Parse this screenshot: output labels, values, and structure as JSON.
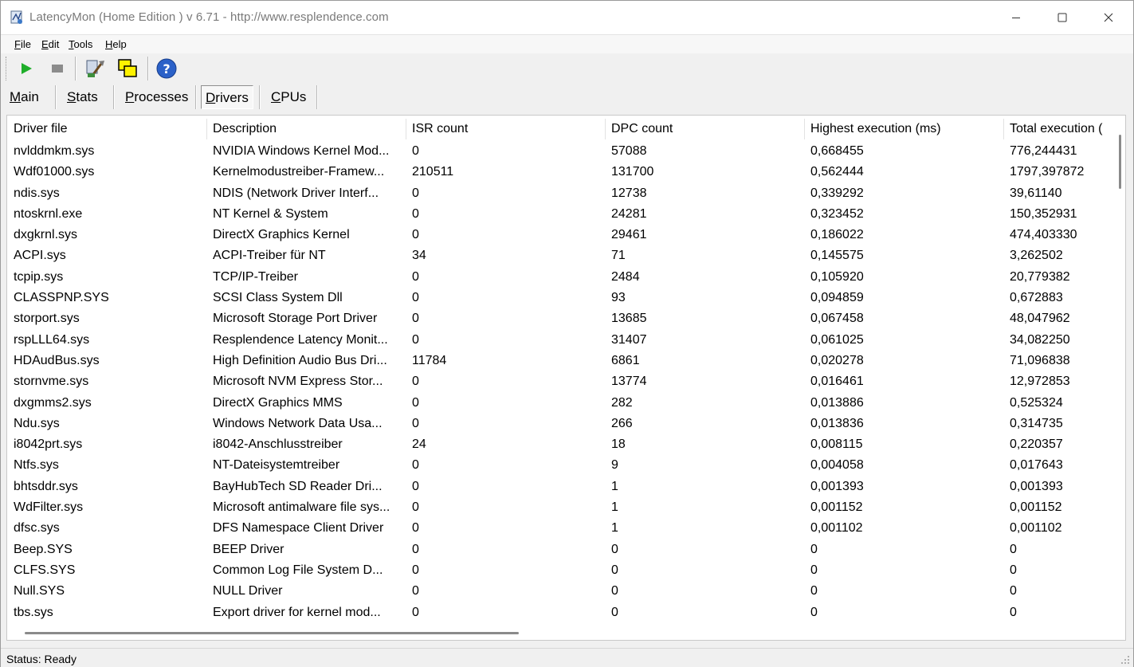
{
  "window": {
    "title": "LatencyMon  (Home Edition )  v 6.71 - http://www.resplendence.com"
  },
  "menu": [
    {
      "hotkey": "F",
      "rest": "ile"
    },
    {
      "hotkey": "E",
      "rest": "dit"
    },
    {
      "hotkey": "T",
      "rest": "ools"
    },
    {
      "hotkey": "H",
      "rest": "elp"
    }
  ],
  "toolbar": {
    "icons": [
      "play-icon",
      "stop-icon",
      "tool-icon",
      "windows-icon",
      "help-icon"
    ],
    "colors": {
      "play": "#1fae2a",
      "stop": "#8c8c8c",
      "help": "#2b61c8"
    }
  },
  "tabs": [
    {
      "hotkey": "M",
      "rest": "ain",
      "active": false
    },
    {
      "hotkey": "S",
      "rest": "tats",
      "active": false
    },
    {
      "hotkey": "P",
      "rest": "rocesses",
      "active": false
    },
    {
      "hotkey": "D",
      "rest": "rivers",
      "active": true
    },
    {
      "hotkey": "C",
      "rest": "PUs",
      "active": false
    }
  ],
  "columns": [
    "Driver file",
    "Description",
    "ISR count",
    "DPC count",
    "Highest execution (ms)",
    "Total execution ("
  ],
  "rows": [
    [
      "nvlddmkm.sys",
      "NVIDIA Windows Kernel Mod...",
      "0",
      "57088",
      "0,668455",
      "776,244431"
    ],
    [
      "Wdf01000.sys",
      "Kernelmodustreiber-Framew...",
      "210511",
      "131700",
      "0,562444",
      "1797,397872"
    ],
    [
      "ndis.sys",
      "NDIS (Network Driver Interf...",
      "0",
      "12738",
      "0,339292",
      "39,61140"
    ],
    [
      "ntoskrnl.exe",
      "NT Kernel & System",
      "0",
      "24281",
      "0,323452",
      "150,352931"
    ],
    [
      "dxgkrnl.sys",
      "DirectX Graphics Kernel",
      "0",
      "29461",
      "0,186022",
      "474,403330"
    ],
    [
      "ACPI.sys",
      "ACPI-Treiber für NT",
      "34",
      "71",
      "0,145575",
      "3,262502"
    ],
    [
      "tcpip.sys",
      "TCP/IP-Treiber",
      "0",
      "2484",
      "0,105920",
      "20,779382"
    ],
    [
      "CLASSPNP.SYS",
      "SCSI Class System Dll",
      "0",
      "93",
      "0,094859",
      "0,672883"
    ],
    [
      "storport.sys",
      "Microsoft Storage Port Driver",
      "0",
      "13685",
      "0,067458",
      "48,047962"
    ],
    [
      "rspLLL64.sys",
      "Resplendence Latency Monit...",
      "0",
      "31407",
      "0,061025",
      "34,082250"
    ],
    [
      "HDAudBus.sys",
      "High Definition Audio Bus Dri...",
      "11784",
      "6861",
      "0,020278",
      "71,096838"
    ],
    [
      "stornvme.sys",
      "Microsoft NVM Express Stor...",
      "0",
      "13774",
      "0,016461",
      "12,972853"
    ],
    [
      "dxgmms2.sys",
      "DirectX Graphics MMS",
      "0",
      "282",
      "0,013886",
      "0,525324"
    ],
    [
      "Ndu.sys",
      "Windows Network Data Usa...",
      "0",
      "266",
      "0,013836",
      "0,314735"
    ],
    [
      "i8042prt.sys",
      "i8042-Anschlusstreiber",
      "24",
      "18",
      "0,008115",
      "0,220357"
    ],
    [
      "Ntfs.sys",
      "NT-Dateisystemtreiber",
      "0",
      "9",
      "0,004058",
      "0,017643"
    ],
    [
      "bhtsddr.sys",
      "BayHubTech SD Reader Dri...",
      "0",
      "1",
      "0,001393",
      "0,001393"
    ],
    [
      "WdFilter.sys",
      "Microsoft antimalware file sys...",
      "0",
      "1",
      "0,001152",
      "0,001152"
    ],
    [
      "dfsc.sys",
      "DFS Namespace Client Driver",
      "0",
      "1",
      "0,001102",
      "0,001102"
    ],
    [
      "Beep.SYS",
      "BEEP Driver",
      "0",
      "0",
      "0",
      "0"
    ],
    [
      "CLFS.SYS",
      "Common Log File System D...",
      "0",
      "0",
      "0",
      "0"
    ],
    [
      "Null.SYS",
      "NULL Driver",
      "0",
      "0",
      "0",
      "0"
    ],
    [
      "tbs.sys",
      "Export driver for kernel mod...",
      "0",
      "0",
      "0",
      "0"
    ]
  ],
  "status": {
    "text": "Status: Ready"
  }
}
